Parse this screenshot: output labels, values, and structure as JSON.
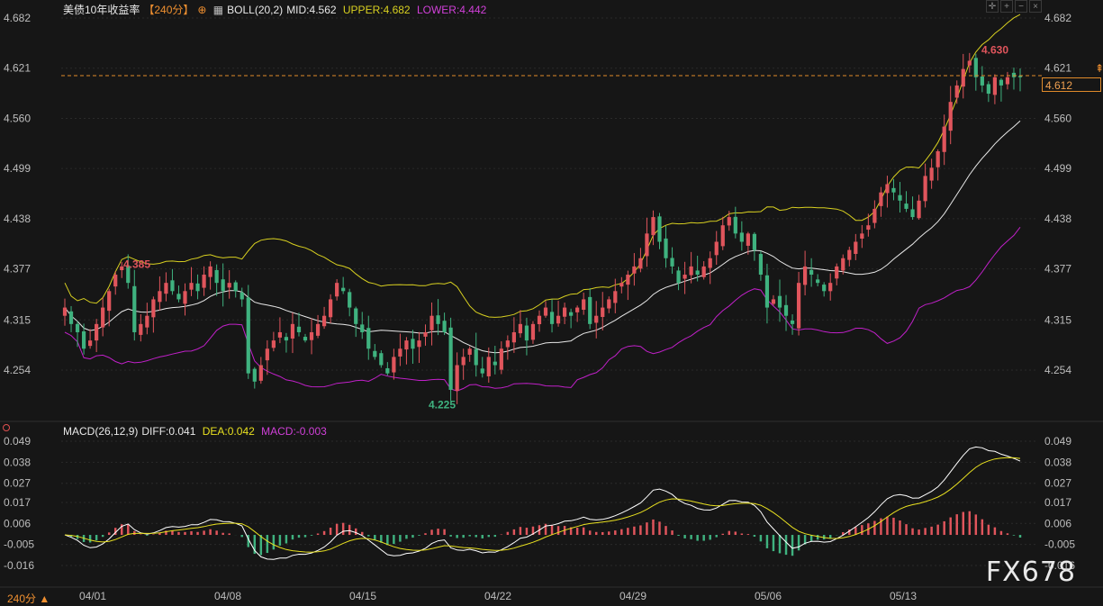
{
  "header": {
    "symbol": "美债10年收益率",
    "period_tag": "【240分】",
    "boll_name": "BOLL(20,2)",
    "boll_mid": "MID:4.562",
    "boll_upper": "UPPER:4.682",
    "boll_lower": "LOWER:4.442"
  },
  "macd_header": {
    "name": "MACD(26,12,9)",
    "diff": "DIFF:0.041",
    "dea": "DEA:0.042",
    "macd": "MACD:-0.003"
  },
  "watermark": "FX678",
  "period_selector": "240分 ▲",
  "current_price": "4.612",
  "colors": {
    "background": "#161616",
    "up": "#e0555c",
    "down": "#3fb27f",
    "boll_mid": "#e8e8e8",
    "boll_upper": "#d8d020",
    "boll_lower": "#c020c8",
    "diff": "#ffffff",
    "dea": "#e8e020",
    "grid": "#2a2a2a",
    "accent": "#f0a050"
  },
  "chart_data": [
    {
      "type": "candlestick",
      "indicator": "BOLL(20,2)",
      "y_ticks": [
        "4.682",
        "4.621",
        "4.560",
        "4.499",
        "4.438",
        "4.377",
        "4.315",
        "4.254"
      ],
      "ylim": [
        4.2,
        4.69
      ],
      "x_ticks": [
        "04/01",
        "04/08",
        "04/15",
        "04/22",
        "04/29",
        "05/06",
        "05/13"
      ],
      "annotations": [
        {
          "label": "4.385",
          "kind": "local-high"
        },
        {
          "label": "4.225",
          "kind": "low"
        },
        {
          "label": "4.630",
          "kind": "high"
        }
      ],
      "last_price": 4.612,
      "close": [
        4.33,
        4.31,
        4.3,
        4.28,
        4.29,
        4.31,
        4.33,
        4.35,
        4.37,
        4.38,
        4.36,
        4.3,
        4.31,
        4.32,
        4.34,
        4.35,
        4.36,
        4.35,
        4.34,
        4.35,
        4.36,
        4.35,
        4.37,
        4.38,
        4.36,
        4.35,
        4.36,
        4.35,
        4.34,
        4.25,
        4.24,
        4.26,
        4.28,
        4.29,
        4.3,
        4.29,
        4.31,
        4.3,
        4.29,
        4.3,
        4.31,
        4.32,
        4.34,
        4.36,
        4.35,
        4.33,
        4.31,
        4.3,
        4.28,
        4.27,
        4.26,
        4.25,
        4.27,
        4.28,
        4.29,
        4.28,
        4.29,
        4.3,
        4.32,
        4.31,
        4.3,
        4.23,
        4.26,
        4.27,
        4.28,
        4.26,
        4.25,
        4.27,
        4.26,
        4.28,
        4.29,
        4.3,
        4.31,
        4.29,
        4.31,
        4.32,
        4.33,
        4.31,
        4.32,
        4.33,
        4.32,
        4.33,
        4.34,
        4.31,
        4.32,
        4.33,
        4.34,
        4.35,
        4.36,
        4.37,
        4.38,
        4.39,
        4.42,
        4.44,
        4.41,
        4.39,
        4.38,
        4.36,
        4.37,
        4.38,
        4.37,
        4.38,
        4.39,
        4.41,
        4.43,
        4.44,
        4.42,
        4.41,
        4.42,
        4.4,
        4.37,
        4.33,
        4.34,
        4.33,
        4.32,
        4.31,
        4.36,
        4.38,
        4.37,
        4.36,
        4.35,
        4.36,
        4.38,
        4.39,
        4.4,
        4.41,
        4.42,
        4.43,
        4.45,
        4.47,
        4.48,
        4.47,
        4.46,
        4.45,
        4.44,
        4.46,
        4.49,
        4.5,
        4.52,
        4.55,
        4.58,
        4.6,
        4.62,
        4.63,
        4.61,
        4.6,
        4.59,
        4.61,
        4.6,
        4.61,
        4.61,
        4.61
      ]
    },
    {
      "type": "macd",
      "indicator": "MACD(26,12,9)",
      "y_ticks": [
        "0.049",
        "0.038",
        "0.027",
        "0.017",
        "0.006",
        "-0.005",
        "-0.016"
      ],
      "ylim": [
        -0.022,
        0.052
      ],
      "diff_last": 0.041,
      "dea_last": 0.042,
      "macd_last": -0.003
    }
  ]
}
